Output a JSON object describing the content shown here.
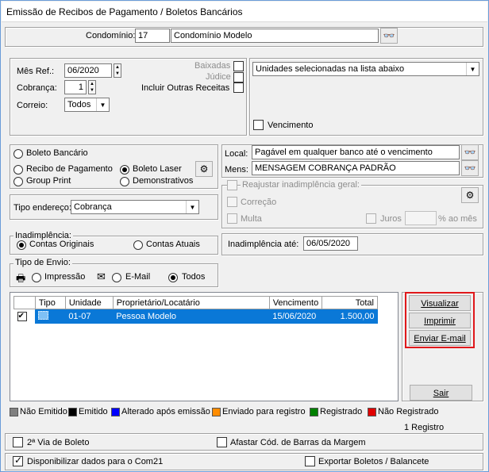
{
  "window": {
    "title": "Emissão de Recibos de Pagamento / Boletos Bancários"
  },
  "condominio": {
    "label": "Condomínio:",
    "code": "17",
    "name": "Condomínio Modelo"
  },
  "filters": {
    "mes_ref_label": "Mês Ref.:",
    "mes_ref_value": "06/2020",
    "cobranca_label": "Cobrança:",
    "cobranca_value": "1",
    "correio_label": "Correio:",
    "correio_value": "Todos",
    "baixadas_label": "Baixadas",
    "judice_label": "Júdice",
    "incluir_label": "Incluir Outras Receitas"
  },
  "unidades": {
    "selected": "Unidades selecionadas na lista abaixo",
    "vencimento_label": "Vencimento"
  },
  "boleto": {
    "bancario": "Boleto Bancário",
    "recibo": "Recibo de Pagamento",
    "group_print": "Group Print",
    "laser": "Boleto Laser",
    "demonstrativos": "Demonstrativos"
  },
  "local": {
    "label": "Local:",
    "value": "Pagável em qualquer banco até o vencimento",
    "mens_label": "Mens:",
    "mens_value": "MENSAGEM COBRANÇA PADRÃO"
  },
  "endereco": {
    "label": "Tipo endereço:",
    "value": "Cobrança"
  },
  "reajuste": {
    "label": "Reajustar inadimplência geral:",
    "correcao": "Correção",
    "multa": "Multa",
    "juros": "Juros",
    "juros_unit": "% ao mês"
  },
  "inadimplencia": {
    "group": "Inadimplência:",
    "originais": "Contas Originais",
    "atuais": "Contas Atuais",
    "ate_label": "Inadimplência até:",
    "ate_value": "06/05/2020"
  },
  "envio": {
    "group": "Tipo de Envio:",
    "impressao": "Impressão",
    "email": "E-Mail",
    "todos": "Todos"
  },
  "table": {
    "headers": [
      "Tipo",
      "Unidade",
      "Proprietário/Locatário",
      "Vencimento",
      "Total"
    ],
    "rows": [
      {
        "unidade": "01-07",
        "nome": "Pessoa Modelo",
        "vencimento": "15/06/2020",
        "total": "1.500,00"
      }
    ]
  },
  "actions": {
    "visualizar": "Visualizar",
    "imprimir": "Imprimir",
    "enviar": "Enviar E-mail",
    "sair": "Sair"
  },
  "legend": [
    {
      "label": "Não Emitido",
      "color": "#808080"
    },
    {
      "label": "Emitido",
      "color": "#000000"
    },
    {
      "label": "Alterado após emissão",
      "color": "#0000ff"
    },
    {
      "label": "Enviado para registro",
      "color": "#ff8c00"
    },
    {
      "label": "Registrado",
      "color": "#008000"
    },
    {
      "label": "Não Registrado",
      "color": "#e00000"
    }
  ],
  "status": {
    "count": "1 Registro"
  },
  "footer": {
    "segunda_via": "2ª Via de Boleto",
    "afastar": "Afastar Cód. de Barras da Margem",
    "com21": "Disponibilizar dados para o Com21",
    "exportar": "Exportar Boletos / Balancete"
  }
}
